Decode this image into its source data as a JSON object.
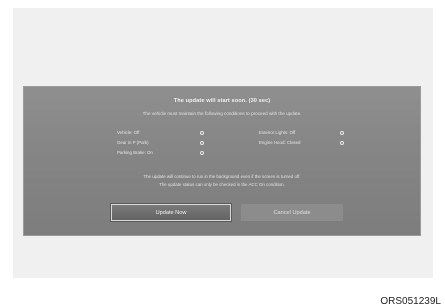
{
  "dialog": {
    "title": "The update will start soon. (30 sec)",
    "subtitle": "The vehicle must maintain the following conditions to proceed with the update.",
    "conditions": [
      {
        "label": "Vehicle: Off"
      },
      {
        "label": "Gear in P (Park)"
      },
      {
        "label": "Parking Brake: On"
      },
      {
        "label": "Exterior Lights: Off"
      },
      {
        "label": "Engine Hood: Closed"
      }
    ],
    "note_line1": "The update will continue to run in the background even if the screen is turned off.",
    "note_line2": "The update status can only be checked in the ACC On condition.",
    "primary_button": "Update Now",
    "secondary_button": "Cancel Update"
  },
  "figure_id": "ORS051239L"
}
